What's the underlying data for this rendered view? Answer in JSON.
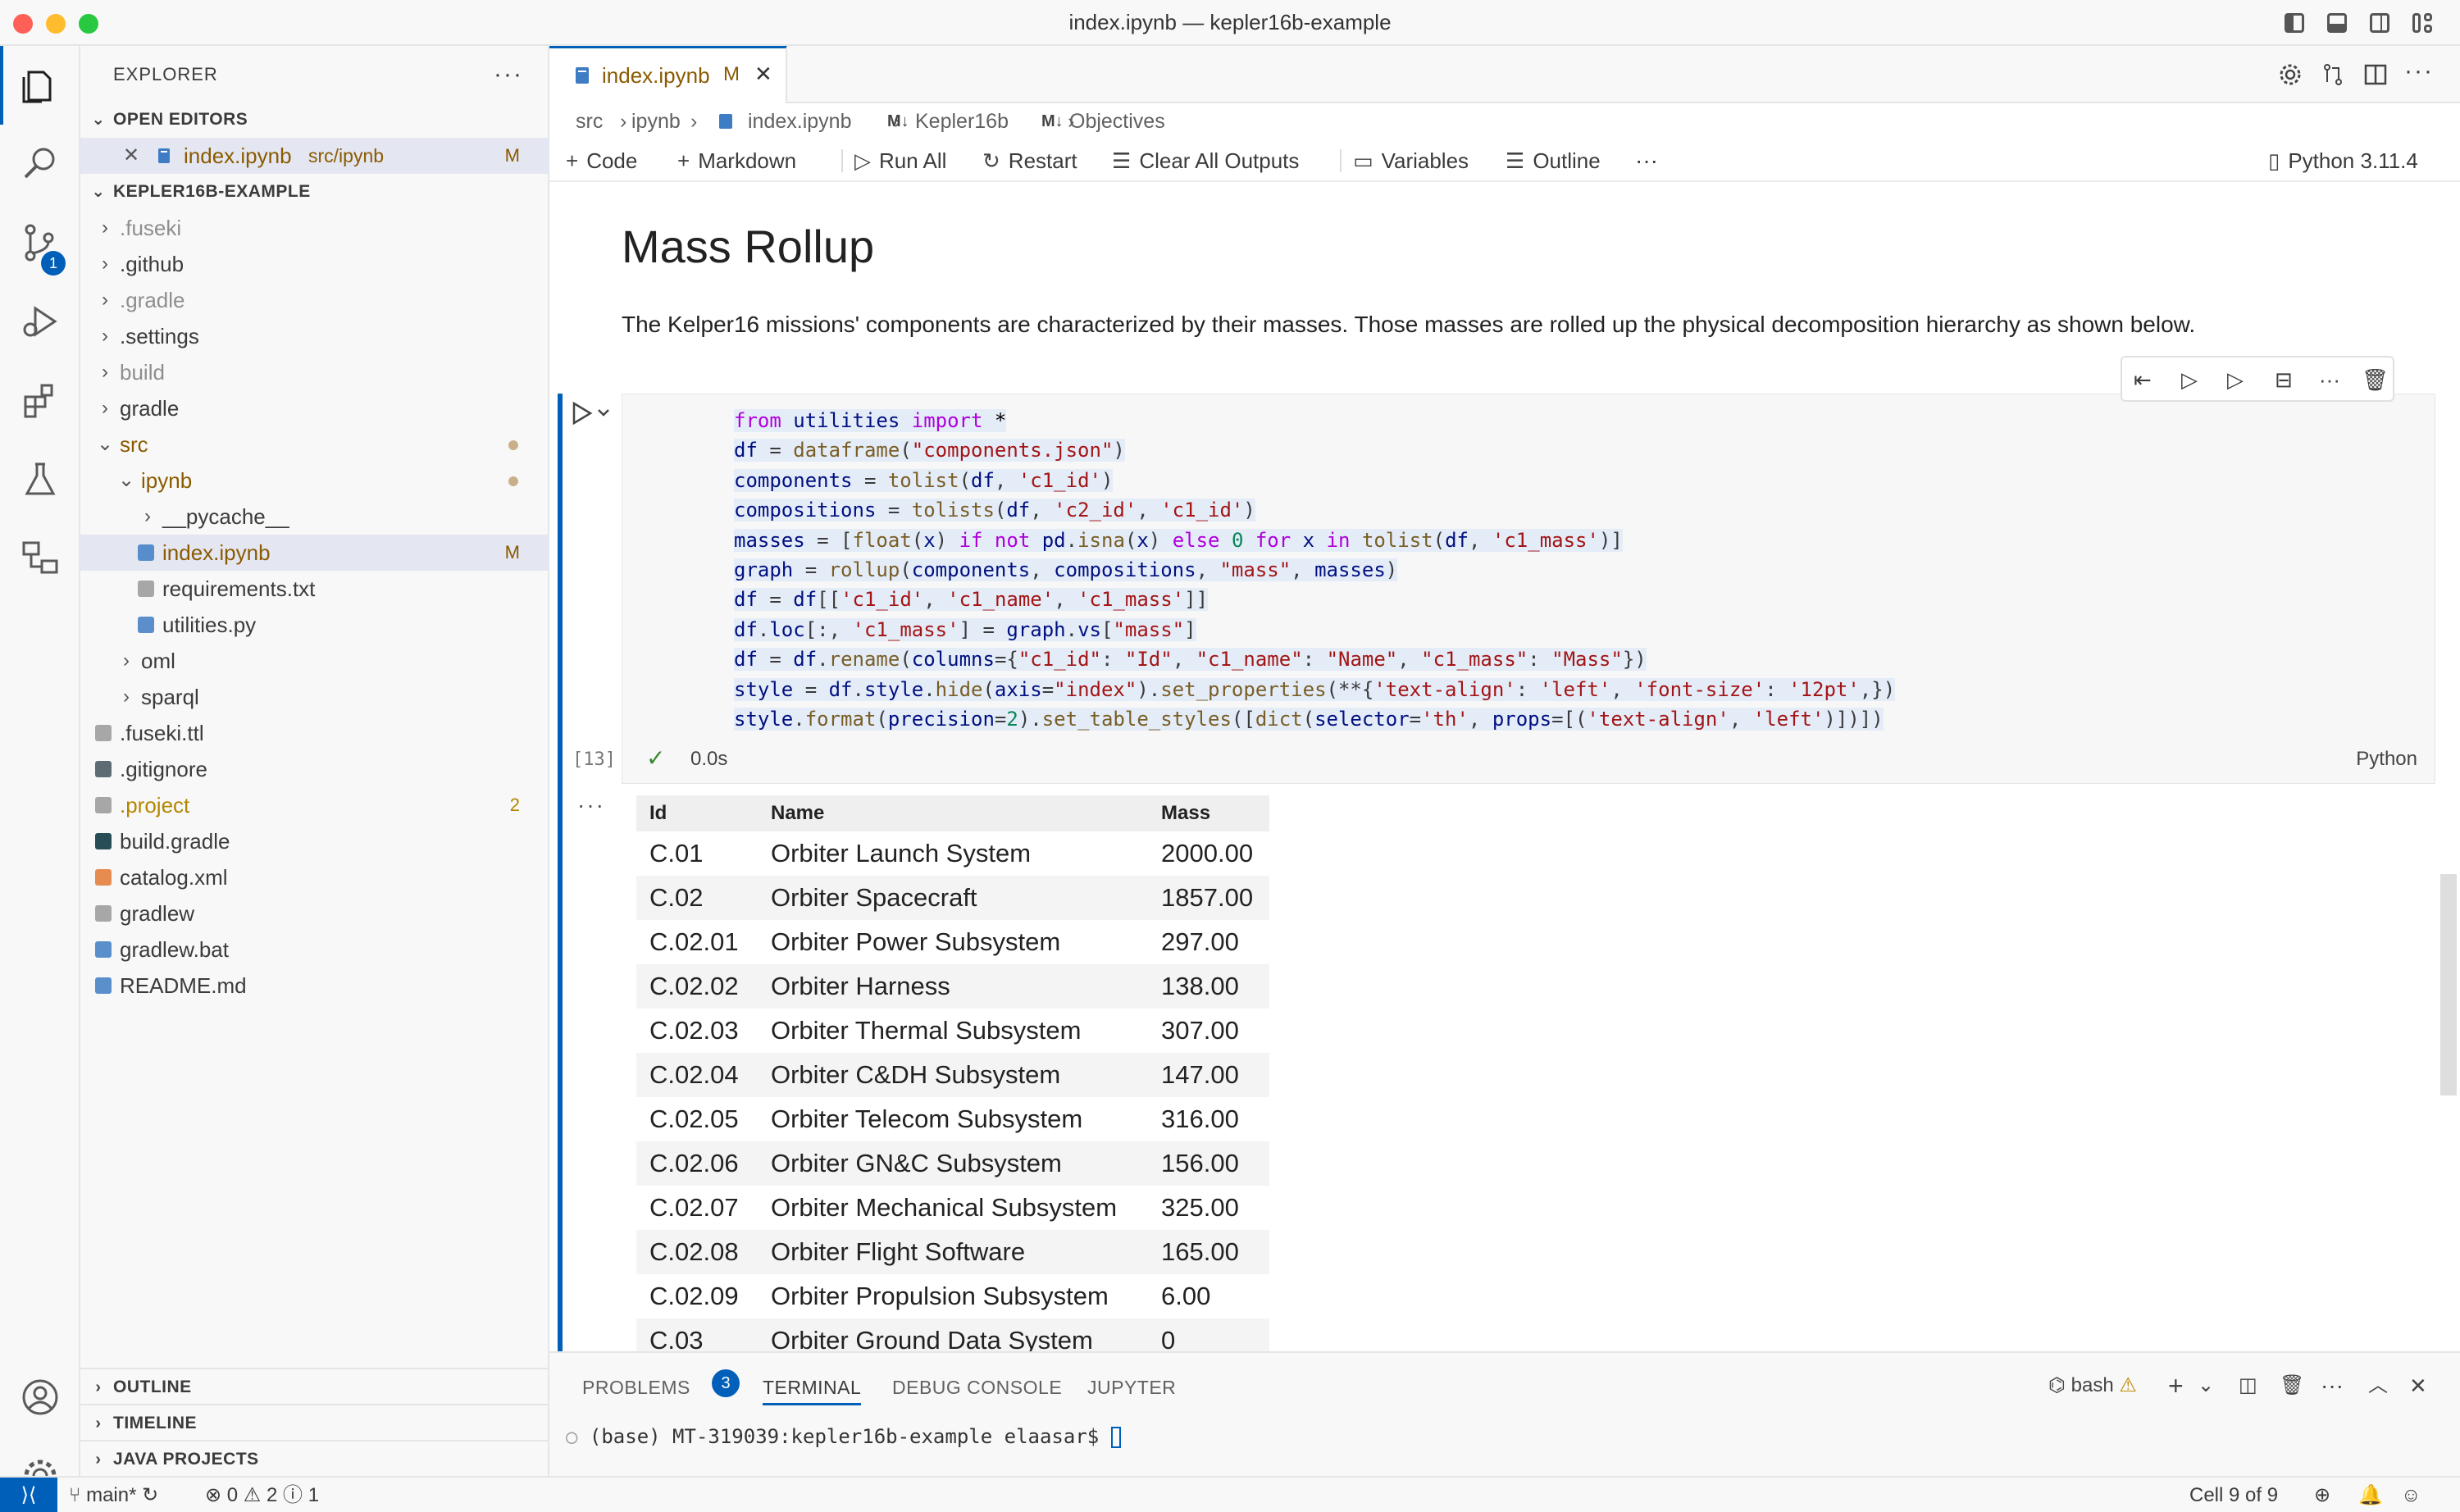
{
  "window": {
    "title": "index.ipynb — kepler16b-example"
  },
  "sidebar": {
    "title": "EXPLORER",
    "open_editors_label": "OPEN EDITORS",
    "open_editor": {
      "name": "index.ipynb",
      "path": "src/ipynb",
      "status": "M"
    },
    "project_label": "KEPLER16B-EXAMPLE",
    "tree": [
      {
        "label": ".fuseki",
        "type": "folder",
        "muted": true
      },
      {
        "label": ".github",
        "type": "folder"
      },
      {
        "label": ".gradle",
        "type": "folder",
        "muted": true
      },
      {
        "label": ".settings",
        "type": "folder"
      },
      {
        "label": "build",
        "type": "folder",
        "muted": true
      },
      {
        "label": "gradle",
        "type": "folder"
      },
      {
        "label": "src",
        "type": "folder",
        "open": true,
        "modified": true
      },
      {
        "label": "ipynb",
        "type": "folder",
        "open": true,
        "modified": true
      },
      {
        "label": "__pycache__",
        "type": "folder"
      },
      {
        "label": "index.ipynb",
        "type": "file",
        "status": "M"
      },
      {
        "label": "requirements.txt",
        "type": "file"
      },
      {
        "label": "utilities.py",
        "type": "file"
      },
      {
        "label": "oml",
        "type": "folder"
      },
      {
        "label": "sparql",
        "type": "folder"
      },
      {
        "label": ".fuseki.ttl",
        "type": "file"
      },
      {
        "label": ".gitignore",
        "type": "file"
      },
      {
        "label": ".project",
        "type": "file",
        "status": "2"
      },
      {
        "label": "build.gradle",
        "type": "file"
      },
      {
        "label": "catalog.xml",
        "type": "file"
      },
      {
        "label": "gradlew",
        "type": "file"
      },
      {
        "label": "gradlew.bat",
        "type": "file"
      },
      {
        "label": "README.md",
        "type": "file"
      }
    ],
    "outline_label": "OUTLINE",
    "timeline_label": "TIMELINE",
    "java_projects_label": "JAVA PROJECTS"
  },
  "activity": {
    "scm_badge": "1"
  },
  "tabs": [
    {
      "label": "index.ipynb",
      "status": "M"
    }
  ],
  "breadcrumb": [
    "src",
    "ipynb",
    "index.ipynb",
    "Kepler16b",
    "Objectives"
  ],
  "toolbar": {
    "code": "Code",
    "markdown": "Markdown",
    "run_all": "Run All",
    "restart": "Restart",
    "clear_outputs": "Clear All Outputs",
    "variables": "Variables",
    "outline": "Outline",
    "more": "···",
    "kernel": "Python 3.11.4"
  },
  "notebook": {
    "heading": "Mass Rollup",
    "paragraph": "The Kelper16 missions' components are characterized by their masses. Those masses are rolled up the physical decomposition hierarchy as shown below.",
    "cell": {
      "execution_count": "[13]",
      "status_check": "✓",
      "time": "0.0s",
      "language": "Python",
      "output_more": "···"
    },
    "table": {
      "headers": [
        "Id",
        "Name",
        "Mass"
      ],
      "rows": [
        [
          "C.01",
          "Orbiter Launch System",
          "2000.00"
        ],
        [
          "C.02",
          "Orbiter Spacecraft",
          "1857.00"
        ],
        [
          "C.02.01",
          "Orbiter Power Subsystem",
          "297.00"
        ],
        [
          "C.02.02",
          "Orbiter Harness",
          "138.00"
        ],
        [
          "C.02.03",
          "Orbiter Thermal Subsystem",
          "307.00"
        ],
        [
          "C.02.04",
          "Orbiter C&DH Subsystem",
          "147.00"
        ],
        [
          "C.02.05",
          "Orbiter Telecom Subsystem",
          "316.00"
        ],
        [
          "C.02.06",
          "Orbiter GN&C Subsystem",
          "156.00"
        ],
        [
          "C.02.07",
          "Orbiter Mechanical Subsystem",
          "325.00"
        ],
        [
          "C.02.08",
          "Orbiter Flight Software",
          "165.00"
        ],
        [
          "C.02.09",
          "Orbiter Propulsion Subsystem",
          "6.00"
        ],
        [
          "C.03",
          "Orbiter Ground Data System",
          "0"
        ]
      ]
    }
  },
  "panel": {
    "tabs": [
      "PROBLEMS",
      "TERMINAL",
      "DEBUG CONSOLE",
      "JUPYTER"
    ],
    "problems_count": "3",
    "shell": "bash",
    "prompt": "(base) MT-319039:kepler16b-example elaasar$ "
  },
  "statusbar": {
    "branch": "main*",
    "errors": "0",
    "warnings": "2",
    "info": "1",
    "cell": "Cell 9 of 9"
  }
}
